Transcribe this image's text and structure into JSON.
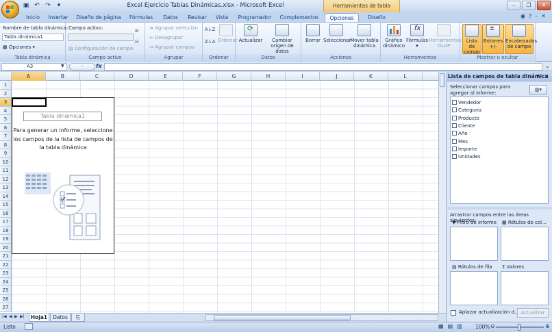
{
  "window": {
    "title": "Excel Ejercicio Tablas Dinámicas.xlsx - Microsoft Excel",
    "context_tools": "Herramientas de tabla dinámica"
  },
  "tabs": [
    {
      "label": "Inicio"
    },
    {
      "label": "Insertar"
    },
    {
      "label": "Diseño de página"
    },
    {
      "label": "Fórmulas"
    },
    {
      "label": "Datos"
    },
    {
      "label": "Revisar"
    },
    {
      "label": "Vista"
    },
    {
      "label": "Programador"
    },
    {
      "label": "Complementos"
    },
    {
      "label": "Opciones"
    },
    {
      "label": "Diseño"
    }
  ],
  "ribbon": {
    "pivot_group": {
      "label": "Tabla dinámica",
      "name_label": "Nombre de tabla dinámica:",
      "name_value": "Tabla dinámica1",
      "options_label": "Opciones"
    },
    "active_field_group": {
      "label": "Campo activo",
      "field_label": "Campo activo:",
      "field_value": "",
      "config_label": "Configuración de campo"
    },
    "group_group": {
      "label": "Agrupar",
      "items": [
        "Agrupar selección",
        "Desagrupar",
        "Agrupar campos"
      ]
    },
    "sort_group": {
      "label": "Ordenar",
      "sort_label": "Ordenar"
    },
    "data_group": {
      "label": "Datos",
      "refresh": "Actualizar",
      "change_source": "Cambiar origen de datos"
    },
    "actions_group": {
      "label": "Acciones",
      "clear": "Borrar",
      "select": "Seleccionar",
      "move": "Mover tabla dinámica"
    },
    "tools_group": {
      "label": "Herramientas",
      "chart": "Gráfico dinámico",
      "formulas": "Fórmulas",
      "olap": "Herramientas OLAP"
    },
    "show_group": {
      "label": "Mostrar u ocultar",
      "field_list": "Lista de campo",
      "buttons": "Botones +/-",
      "headers": "Encabezados de campo"
    }
  },
  "formula_bar": {
    "name_box": "A3",
    "fx": "fx",
    "value": ""
  },
  "sheet": {
    "columns": [
      "A",
      "B",
      "C",
      "D",
      "E",
      "F",
      "G",
      "H",
      "I",
      "J",
      "K",
      "L"
    ],
    "rows": [
      "1",
      "2",
      "3",
      "4",
      "5",
      "6",
      "7",
      "8",
      "9",
      "10",
      "11",
      "12",
      "13",
      "14",
      "15",
      "16",
      "17",
      "18",
      "19",
      "20",
      "21",
      "22",
      "23",
      "24",
      "25",
      "26",
      "27"
    ],
    "selected_column": "A",
    "selected_row": "3",
    "pivot_placeholder": {
      "title": "Tabla dinámica1",
      "message": "Para generar un informe, seleccione los campos de la lista de campos de la tabla dinámica"
    },
    "sheet_tabs": [
      "Hoja1",
      "Datos"
    ],
    "active_sheet": "Hoja1"
  },
  "status": {
    "left": "Listo",
    "zoom": "100%"
  },
  "task_pane": {
    "title": "Lista de campos de tabla dinámica",
    "select_prompt": "Seleccionar campos para agregar al informe:",
    "fields": [
      {
        "label": "Vendedor",
        "checked": false
      },
      {
        "label": "Categoría",
        "checked": false
      },
      {
        "label": "Producto",
        "checked": false
      },
      {
        "label": "Cliente",
        "checked": false
      },
      {
        "label": "Año",
        "checked": false
      },
      {
        "label": "Mes",
        "checked": false
      },
      {
        "label": "Importe",
        "checked": false
      },
      {
        "label": "Unidades",
        "checked": false
      }
    ],
    "drag_prompt": "Arrastrar campos entre las áreas siguientes:",
    "areas": {
      "filter": "Filtro de informe",
      "columns": "Rótulos de col...",
      "rows": "Rótulos de fila",
      "values": "Valores"
    },
    "defer_label": "Aplazar actualización d...",
    "update_button": "Actualizar"
  },
  "colors": {
    "accent": "#f1c15f",
    "ribbon_bg": "#e3edfa",
    "pane_bg": "#dde7f5"
  }
}
